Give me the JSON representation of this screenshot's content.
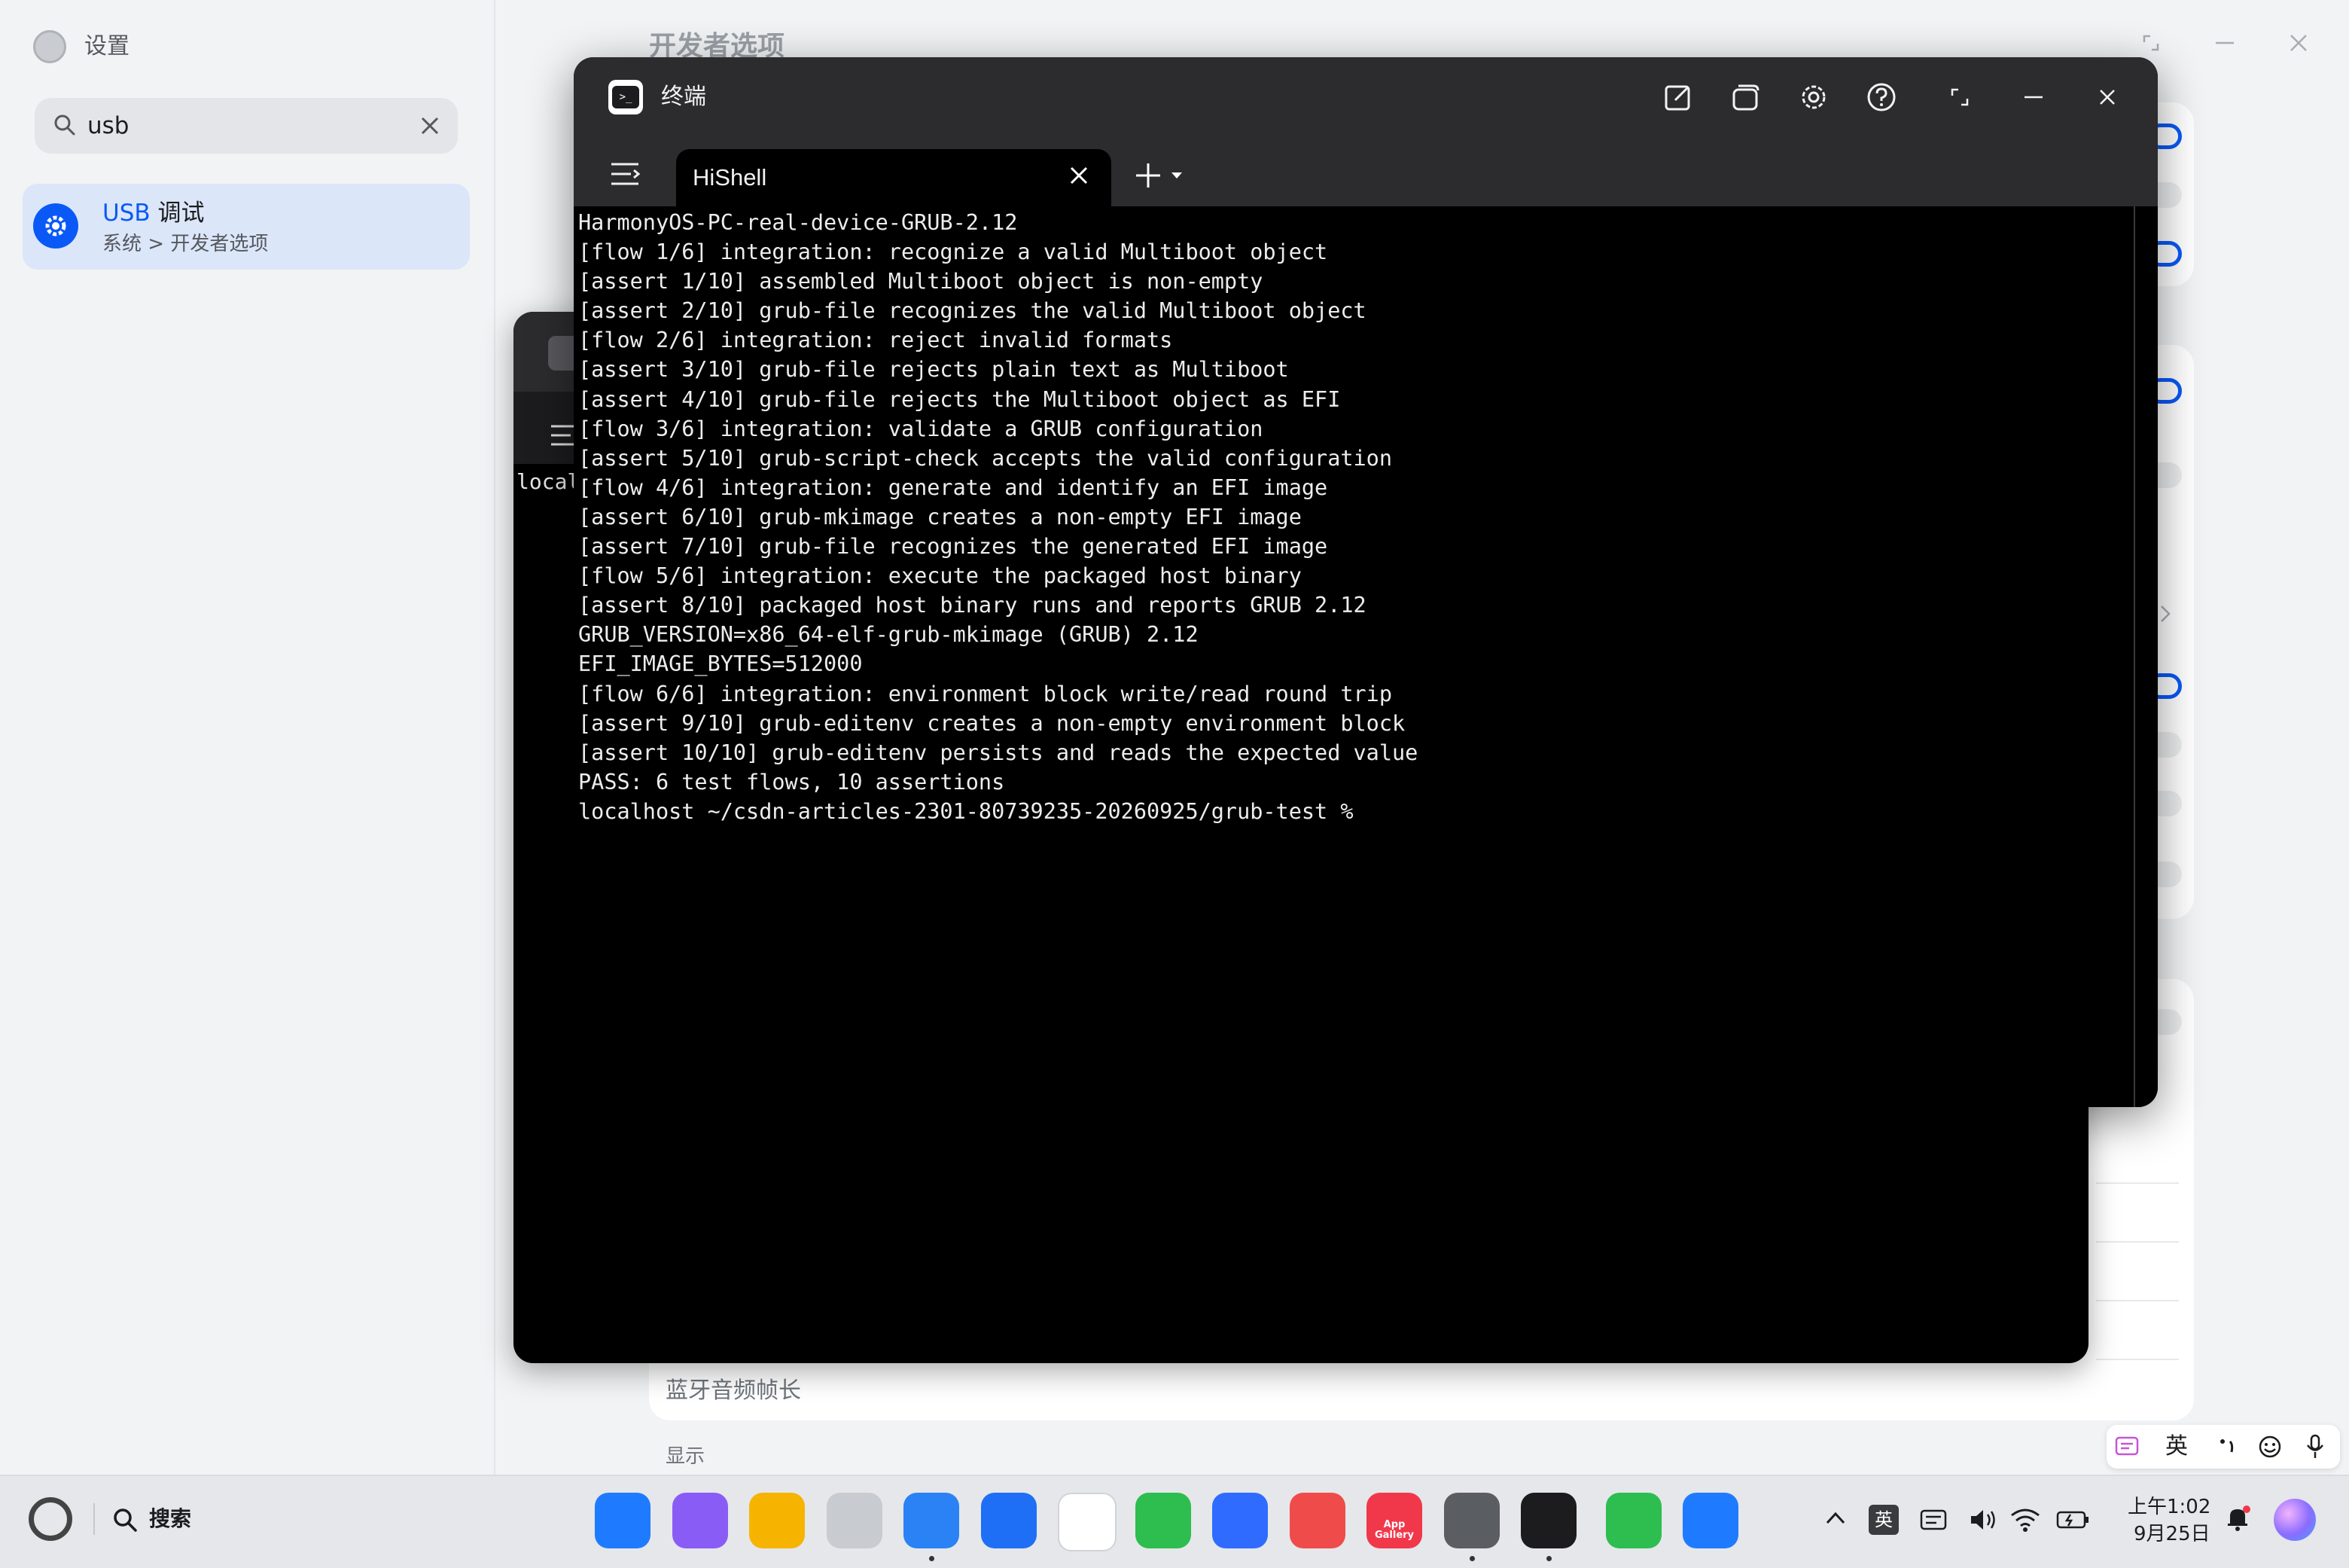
{
  "settings": {
    "app_title": "设置",
    "search_value": "usb",
    "result": {
      "title_highlight": "USB",
      "title_rest": " 调试",
      "subtitle": "系统 > 开发者选项"
    },
    "page_heading": "开发者选项",
    "bluetooth_label": "蓝牙音频帧长",
    "display_label": "显示",
    "accent_color": "#0a59f7"
  },
  "terminal_back": {
    "visible_text": "local"
  },
  "terminal": {
    "window_title": "终端",
    "tab_label": "HiShell",
    "lines": [
      "HarmonyOS-PC-real-device-GRUB-2.12",
      "[flow 1/6] integration: recognize a valid Multiboot object",
      "[assert 1/10] assembled Multiboot object is non-empty",
      "[assert 2/10] grub-file recognizes the valid Multiboot object",
      "[flow 2/6] integration: reject invalid formats",
      "[assert 3/10] grub-file rejects plain text as Multiboot",
      "[assert 4/10] grub-file rejects the Multiboot object as EFI",
      "[flow 3/6] integration: validate a GRUB configuration",
      "[assert 5/10] grub-script-check accepts the valid configuration",
      "[flow 4/6] integration: generate and identify an EFI image",
      "[assert 6/10] grub-mkimage creates a non-empty EFI image",
      "[assert 7/10] grub-file recognizes the generated EFI image",
      "[flow 5/6] integration: execute the packaged host binary",
      "[assert 8/10] packaged host binary runs and reports GRUB 2.12",
      "GRUB_VERSION=x86_64-elf-grub-mkimage (GRUB) 2.12",
      "EFI_IMAGE_BYTES=512000",
      "[flow 6/6] integration: environment block write/read round trip",
      "[assert 9/10] grub-editenv creates a non-empty environment block",
      "[assert 10/10] grub-editenv persists and reads the expected value",
      "PASS: 6 test flows, 10 assertions",
      "localhost ~/csdn-articles-2301-80739235-20260925/grub-test %"
    ]
  },
  "ime": {
    "lang": "英"
  },
  "taskbar": {
    "search_label": "搜索",
    "dock": [
      {
        "name": "app-center",
        "color": "#1e7bff"
      },
      {
        "name": "multi-window",
        "color": "#8a5cf6"
      },
      {
        "name": "files",
        "color": "#f6b400"
      },
      {
        "name": "recycle-bin",
        "color": "#c8cbd0"
      },
      {
        "name": "browser",
        "color": "#2a82f4"
      },
      {
        "name": "mail",
        "color": "#1e6ff5"
      },
      {
        "name": "gallery",
        "color": "#ffffff"
      },
      {
        "name": "messages",
        "color": "#2ebd4f"
      },
      {
        "name": "music",
        "color": "#2f6bff"
      },
      {
        "name": "books",
        "color": "#f04b4b"
      },
      {
        "name": "app-gallery",
        "color": "#f0384a",
        "label": "App Gallery"
      },
      {
        "name": "settings",
        "color": "#5a5d62"
      },
      {
        "name": "terminal",
        "color": "#1c1c1e"
      },
      {
        "name": "phone",
        "color": "#2ebd4f"
      },
      {
        "name": "chat",
        "color": "#1e7bff"
      }
    ],
    "tray": {
      "ime_lang": "英",
      "time": "上午1:02",
      "date": "9月25日"
    }
  }
}
